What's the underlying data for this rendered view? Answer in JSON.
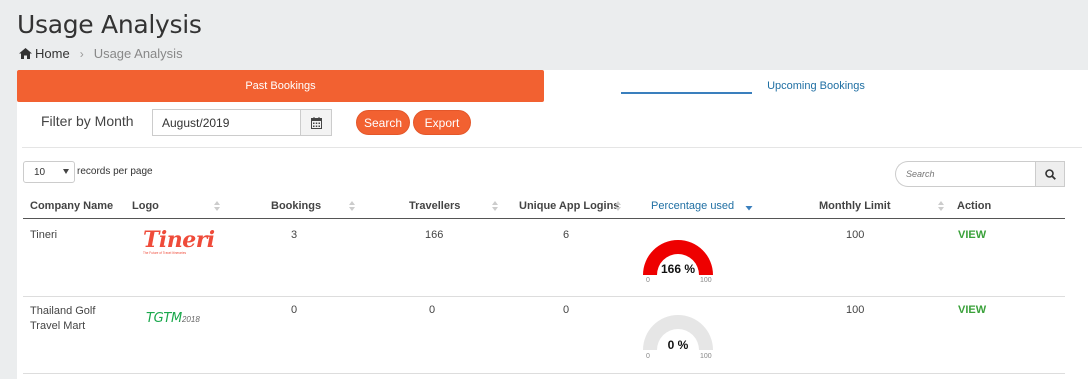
{
  "page": {
    "title": "Usage Analysis"
  },
  "breadcrumb": {
    "home": "Home",
    "current": "Usage Analysis"
  },
  "tabs": [
    {
      "label": "Past Bookings",
      "active": true
    },
    {
      "label": "Upcoming Bookings",
      "active": false
    }
  ],
  "filter": {
    "label": "Filter by Month",
    "month_value": "August/2019",
    "search_button": "Search",
    "export_button": "Export"
  },
  "table_controls": {
    "page_size": "10",
    "per_page_label": "records per page",
    "search_placeholder": "Search"
  },
  "columns": [
    "Company Name",
    "Logo",
    "Bookings",
    "Travellers",
    "Unique App Logins",
    "Percentage used",
    "Monthly Limit",
    "Action"
  ],
  "rows": [
    {
      "company": "Tineri",
      "logo_text": "Tineri",
      "logo_tagline": "The Future of Travel Itineraries",
      "bookings": "3",
      "travellers": "166",
      "unique_logins": "6",
      "percentage_text": "166 %",
      "percentage": 166,
      "monthly_limit": "100",
      "action": "VIEW",
      "gauge_min": "0",
      "gauge_max": "100"
    },
    {
      "company": "Thailand Golf Travel Mart",
      "logo_text": "TGTM",
      "logo_suffix": "2018",
      "bookings": "0",
      "travellers": "0",
      "unique_logins": "0",
      "percentage_text": "0 %",
      "percentage": 0,
      "monthly_limit": "100",
      "action": "VIEW",
      "gauge_min": "0",
      "gauge_max": "100"
    }
  ],
  "colors": {
    "accent": "#f26131",
    "link": "#1f6fa3",
    "view": "#3aa13a",
    "gauge_over": "#ee0000",
    "gauge_track": "#e6e6e6"
  },
  "icons": [
    "home-icon",
    "calendar-icon",
    "search-icon",
    "sort-icon",
    "sort-desc-icon",
    "chevron-right-icon"
  ]
}
